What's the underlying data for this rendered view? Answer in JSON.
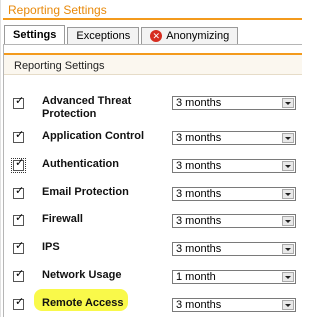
{
  "window": {
    "title": "Reporting Settings"
  },
  "tabs": [
    {
      "label": "Settings",
      "active": true
    },
    {
      "label": "Exceptions",
      "active": false
    },
    {
      "label": "Anonymizing",
      "active": false,
      "icon": "x-icon"
    }
  ],
  "section": {
    "title": "Reporting Settings"
  },
  "settings": [
    {
      "label": "Advanced Threat Protection",
      "checked": true,
      "value": "3 months"
    },
    {
      "label": "Application Control",
      "checked": true,
      "value": "3 months"
    },
    {
      "label": "Authentication",
      "checked": true,
      "value": "3 months"
    },
    {
      "label": "Email Protection",
      "checked": true,
      "value": "3 months"
    },
    {
      "label": "Firewall",
      "checked": true,
      "value": "3 months"
    },
    {
      "label": "IPS",
      "checked": true,
      "value": "3 months"
    },
    {
      "label": "Network Usage",
      "checked": true,
      "value": "1 month"
    },
    {
      "label": "Remote Access",
      "checked": true,
      "value": "3 months"
    }
  ],
  "colors": {
    "accent": "#f39a1c",
    "highlight": "#ffff00",
    "close_icon": "#d62d20"
  }
}
